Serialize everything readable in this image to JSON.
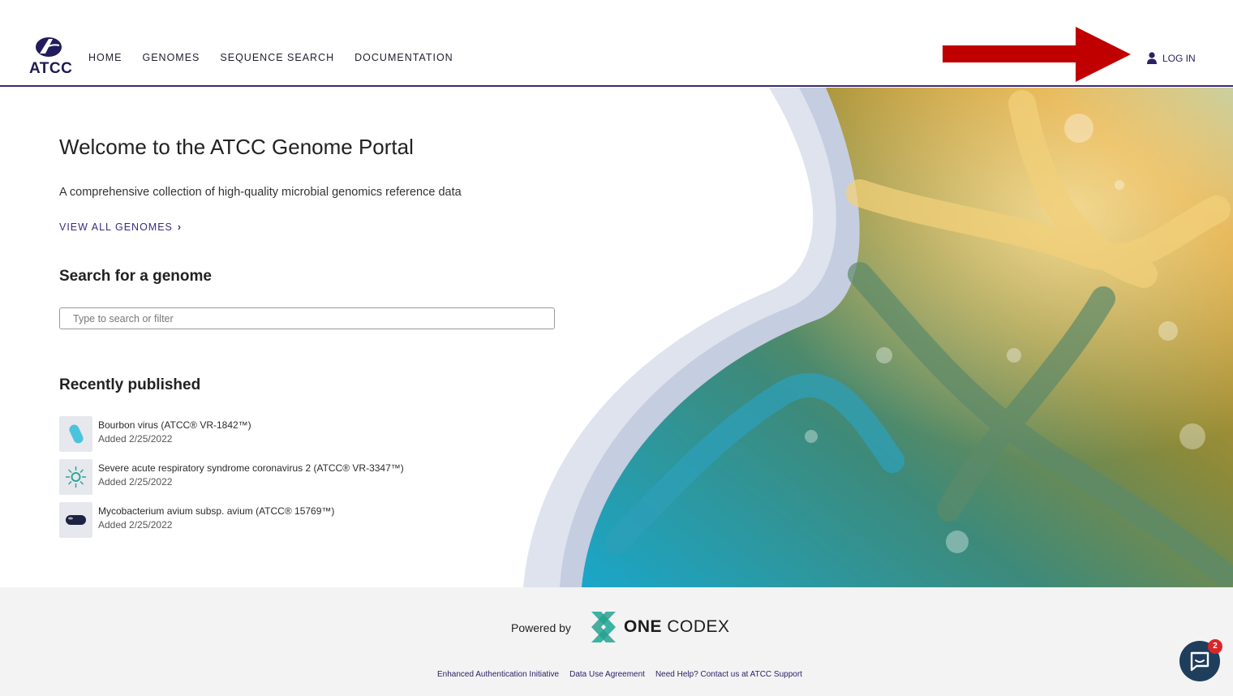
{
  "header": {
    "logo_text": "ATCC",
    "nav": [
      {
        "label": "HOME"
      },
      {
        "label": "GENOMES"
      },
      {
        "label": "SEQUENCE SEARCH"
      },
      {
        "label": "DOCUMENTATION"
      }
    ],
    "login_label": "LOG IN"
  },
  "main": {
    "title": "Welcome to the ATCC Genome Portal",
    "subtitle": "A comprehensive collection of high-quality microbial genomics reference data",
    "view_all_label": "VIEW ALL GENOMES",
    "search_title": "Search for a genome",
    "search_placeholder": "Type to search or filter",
    "recent_title": "Recently published",
    "recent": [
      {
        "name": "Bourbon virus (ATCC® VR-1842™)",
        "date": "Added 2/25/2022",
        "icon": "virus-capsule-icon"
      },
      {
        "name": "Severe acute respiratory syndrome coronavirus 2 (ATCC® VR-3347™)",
        "date": "Added 2/25/2022",
        "icon": "coronavirus-icon"
      },
      {
        "name": "Mycobacterium avium subsp. avium (ATCC® 15769™)",
        "date": "Added 2/25/2022",
        "icon": "bacterium-icon"
      }
    ]
  },
  "footer": {
    "powered_by": "Powered by",
    "brand_bold": "ONE",
    "brand_rest": " CODEX",
    "links": [
      {
        "label": "Enhanced Authentication Initiative"
      },
      {
        "label": "Data Use Agreement"
      },
      {
        "label": "Need Help? Contact us at ATCC Support"
      }
    ]
  },
  "chat": {
    "badge_count": "2"
  },
  "colors": {
    "brand_purple": "#3c2a6e",
    "arrow_red": "#c00000",
    "chat_blue": "#1f3e5b"
  }
}
